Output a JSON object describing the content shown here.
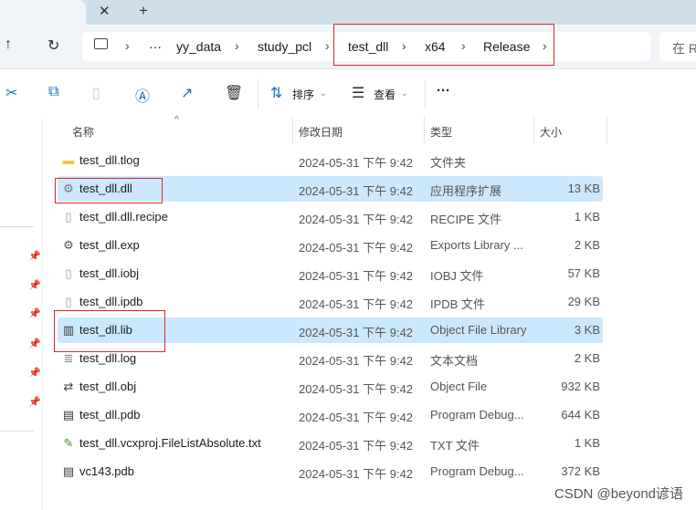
{
  "tabbar": {
    "close_icon": "close-icon",
    "new_tab": "+"
  },
  "address": {
    "crumbs": [
      "yy_data",
      "study_pcl",
      "test_dll",
      "x64",
      "Release"
    ],
    "ellipsis": "···",
    "search_placeholder": "在 R"
  },
  "toolbar": {
    "sort_label": "排序",
    "view_label": "查看",
    "more": "···"
  },
  "columns": {
    "name": "名称",
    "date": "修改日期",
    "type": "类型",
    "size": "大小"
  },
  "files": [
    {
      "name": "test_dll.tlog",
      "date": "2024-05-31 下午 9:42",
      "type": "文件夹",
      "size": "",
      "icon": "folder-icon",
      "selected": false
    },
    {
      "name": "test_dll.dll",
      "date": "2024-05-31 下午 9:42",
      "type": "应用程序扩展",
      "size": "13 KB",
      "icon": "dll-icon",
      "selected": true
    },
    {
      "name": "test_dll.dll.recipe",
      "date": "2024-05-31 下午 9:42",
      "type": "RECIPE 文件",
      "size": "1 KB",
      "icon": "file-icon",
      "selected": false
    },
    {
      "name": "test_dll.exp",
      "date": "2024-05-31 下午 9:42",
      "type": "Exports Library ...",
      "size": "2 KB",
      "icon": "exp-icon",
      "selected": false
    },
    {
      "name": "test_dll.iobj",
      "date": "2024-05-31 下午 9:42",
      "type": "IOBJ 文件",
      "size": "57 KB",
      "icon": "file-icon",
      "selected": false
    },
    {
      "name": "test_dll.ipdb",
      "date": "2024-05-31 下午 9:42",
      "type": "IPDB 文件",
      "size": "29 KB",
      "icon": "file-icon",
      "selected": false
    },
    {
      "name": "test_dll.lib",
      "date": "2024-05-31 下午 9:42",
      "type": "Object File Library",
      "size": "3 KB",
      "icon": "library-icon",
      "selected": true
    },
    {
      "name": "test_dll.log",
      "date": "2024-05-31 下午 9:42",
      "type": "文本文档",
      "size": "2 KB",
      "icon": "text-file-icon",
      "selected": false
    },
    {
      "name": "test_dll.obj",
      "date": "2024-05-31 下午 9:42",
      "type": "Object File",
      "size": "932 KB",
      "icon": "obj-icon",
      "selected": false
    },
    {
      "name": "test_dll.pdb",
      "date": "2024-05-31 下午 9:42",
      "type": "Program Debug...",
      "size": "644 KB",
      "icon": "pdb-icon",
      "selected": false
    },
    {
      "name": "test_dll.vcxproj.FileListAbsolute.txt",
      "date": "2024-05-31 下午 9:42",
      "type": "TXT 文件",
      "size": "1 KB",
      "icon": "txt-icon",
      "selected": false
    },
    {
      "name": "vc143.pdb",
      "date": "2024-05-31 下午 9:42",
      "type": "Program Debug...",
      "size": "372 KB",
      "icon": "pdb-icon",
      "selected": false
    }
  ],
  "watermark": "CSDN @beyond谚语"
}
